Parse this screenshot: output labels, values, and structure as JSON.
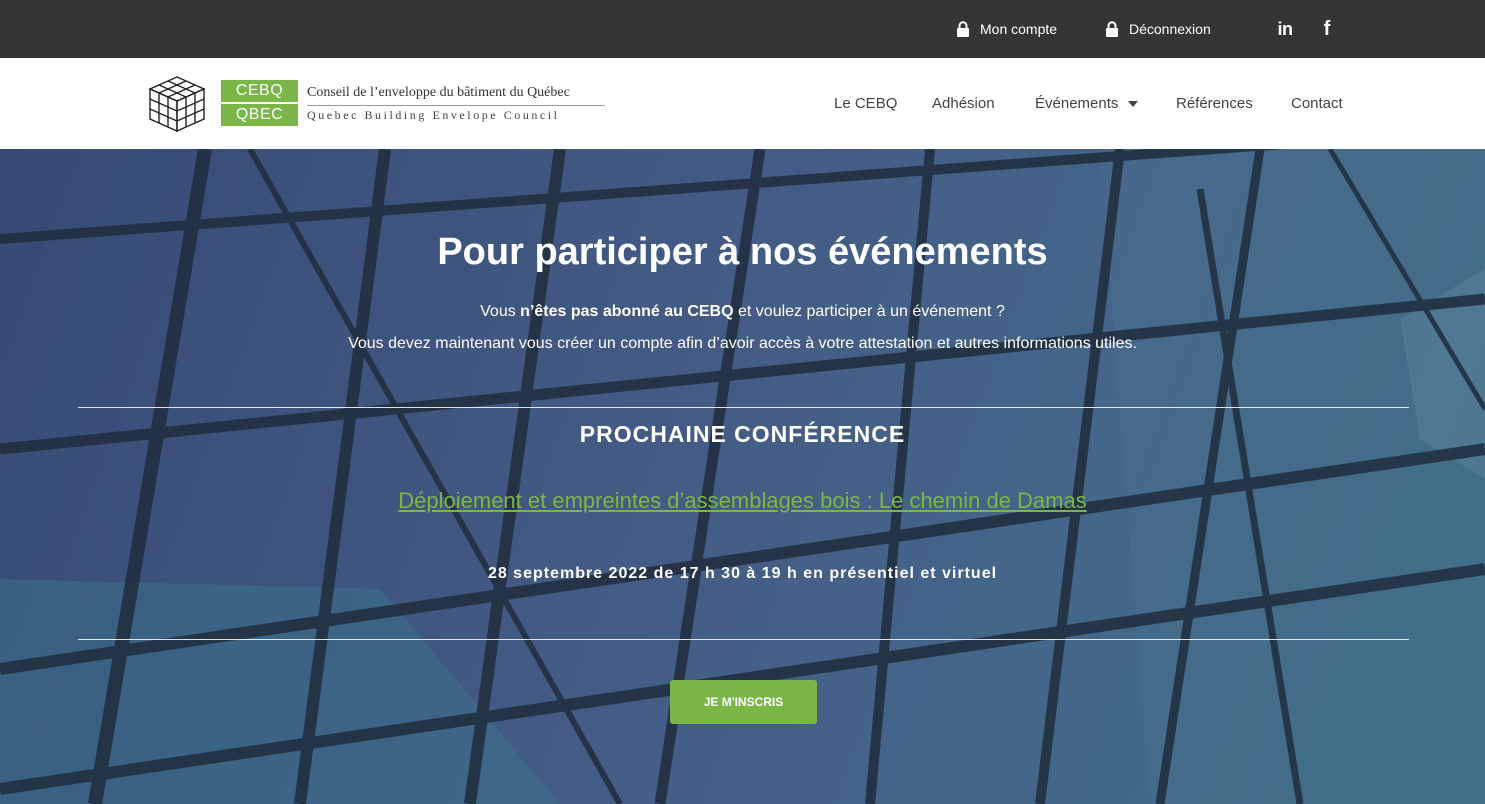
{
  "topbar": {
    "account_label": "Mon compte",
    "logout_label": "Déconnexion",
    "linkedin_glyph": "in",
    "facebook_glyph": "f",
    "icons": [
      "lock-icon",
      "linkedin-icon",
      "facebook-icon"
    ]
  },
  "logo": {
    "acronym_fr": "CEBQ",
    "acronym_en": "QBEC",
    "name_fr": "Conseil de l’enveloppe du bâtiment du Québec",
    "name_en": "Quebec Building Envelope Council"
  },
  "nav": {
    "items": [
      {
        "label": "Le CEBQ"
      },
      {
        "label": "Adhésion"
      },
      {
        "label": "Événements"
      },
      {
        "label": "Références"
      },
      {
        "label": "Contact"
      }
    ]
  },
  "hero": {
    "title": "Pour participer à nos événements",
    "line1_pre": "Vous ",
    "line1_bold": "n’êtes pas abonné au CEBQ",
    "line1_post": " et voulez participer à un événement ?",
    "line2": "Vous devez maintenant vous créer un compte afin d’avoir accès à votre attestation et autres informations utiles.",
    "conference_heading": "PROCHAINE CONFÉRENCE",
    "conference_title": "Déploiement et empreintes d’assemblages bois : Le chemin de Damas",
    "conference_date": "28 septembre 2022 de 17 h 30 à 19 h en présentiel et virtuel",
    "cta_label": "JE M'INSCRIS"
  },
  "colors": {
    "topbar": "#353535",
    "accent_green": "#7ab648",
    "nav_text": "#444444",
    "hero_blue": "#4c6690"
  }
}
